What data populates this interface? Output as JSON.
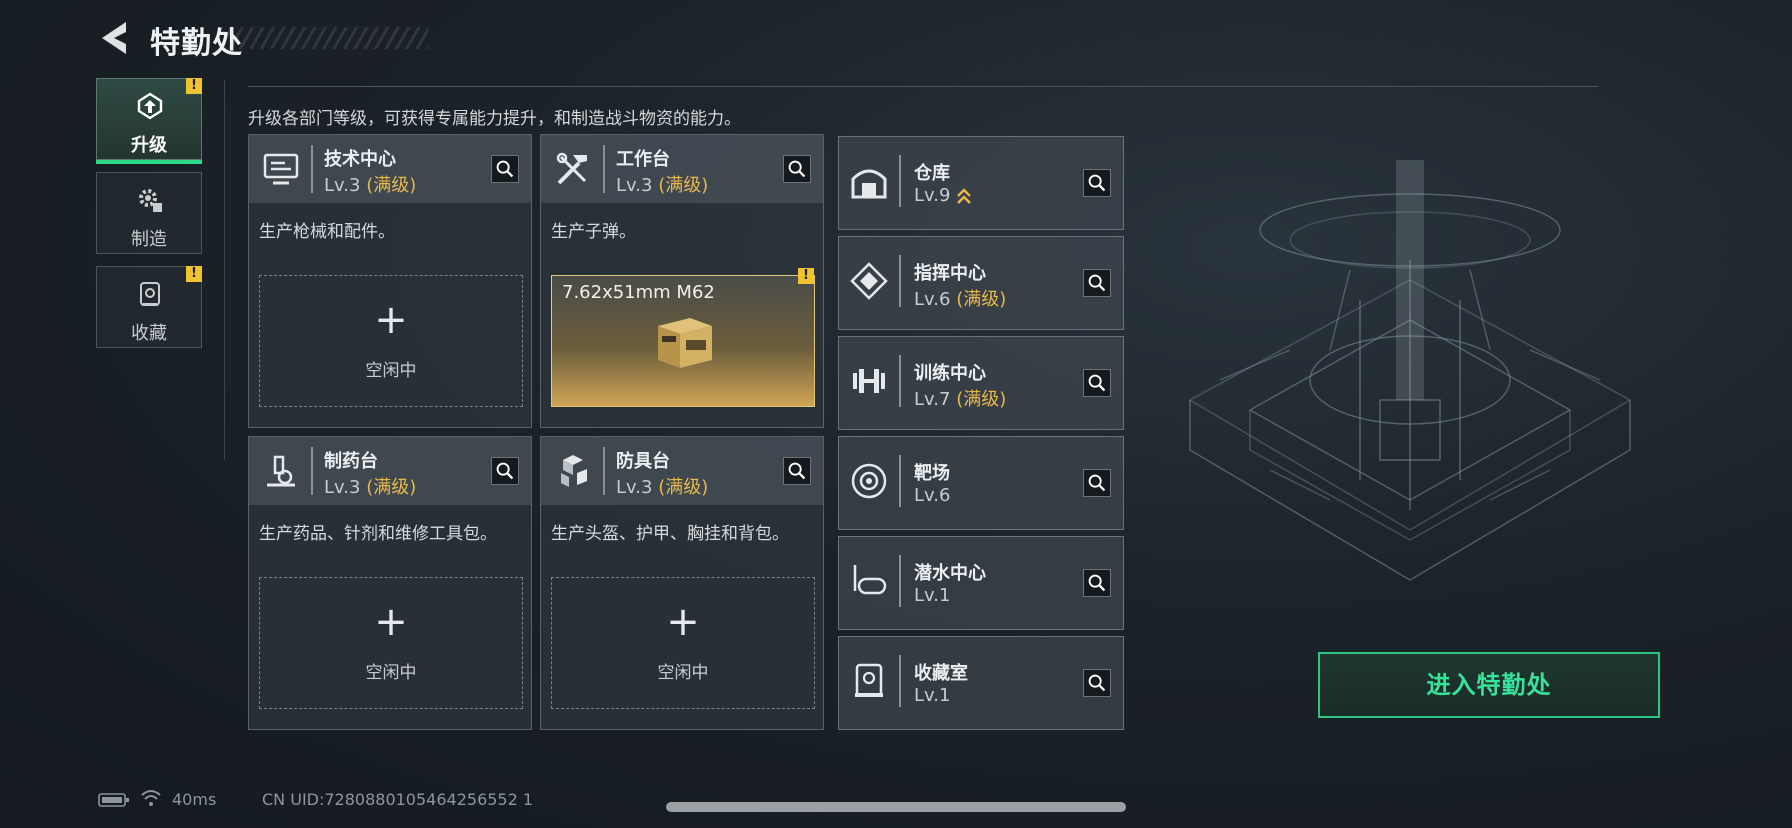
{
  "header": {
    "title": "特勤处"
  },
  "description": "升级各部门等级，可获得专属能力提升，和制造战斗物资的能力。",
  "tabs": [
    {
      "label": "升级",
      "active": true,
      "alert": "!"
    },
    {
      "label": "制造",
      "active": false
    },
    {
      "label": "收藏",
      "active": false,
      "alert": "!"
    }
  ],
  "stations": [
    {
      "name": "技术中心",
      "level": "Lv.3",
      "max": "(满级)",
      "desc": "生产枪械和配件。",
      "slot": {
        "plus": "+",
        "status": "空闲中"
      }
    },
    {
      "name": "工作台",
      "level": "Lv.3",
      "max": "(满级)",
      "desc": "生产子弹。",
      "product": {
        "name": "7.62x51mm M62",
        "alert": "!"
      }
    },
    {
      "name": "制药台",
      "level": "Lv.3",
      "max": "(满级)",
      "desc": "生产药品、针剂和维修工具包。",
      "slot": {
        "plus": "+",
        "status": "空闲中"
      }
    },
    {
      "name": "防具台",
      "level": "Lv.3",
      "max": "(满级)",
      "desc": "生产头盔、护甲、胸挂和背包。",
      "slot": {
        "plus": "+",
        "status": "空闲中"
      }
    }
  ],
  "facilities": [
    {
      "name": "仓库",
      "level": "Lv.9",
      "max": "",
      "icon": "warehouse-icon",
      "upgrade_arrow": "upgrade-available-icon"
    },
    {
      "name": "指挥中心",
      "level": "Lv.6",
      "max": "(满级)",
      "icon": "command-center-icon"
    },
    {
      "name": "训练中心",
      "level": "Lv.7",
      "max": "(满级)",
      "icon": "dumbbell-icon"
    },
    {
      "name": "靶场",
      "level": "Lv.6",
      "max": "",
      "icon": "target-icon"
    },
    {
      "name": "潜水中心",
      "level": "Lv.1",
      "max": "",
      "icon": "diving-mask-icon"
    },
    {
      "name": "收藏室",
      "level": "Lv.1",
      "max": "",
      "icon": "collection-room-icon"
    }
  ],
  "enter_button": "进入特勤处",
  "footer": {
    "latency": "40ms",
    "uid": "CN UID:7280880105464256552 1"
  },
  "colors": {
    "accent": "#2bd987",
    "max_level": "#e9b84a",
    "alert": "#f0c430"
  }
}
